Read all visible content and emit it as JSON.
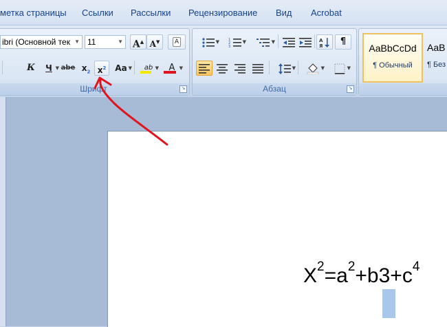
{
  "menu_tabs": [
    "метка страницы",
    "Ссылки",
    "Рассылки",
    "Рецензирование",
    "Вид",
    "Acrobat"
  ],
  "font_group": {
    "font_name": "ibri (Основной тек",
    "font_size": "11",
    "grow_font": "A",
    "shrink_font": "A",
    "clear_format_glyph": "A",
    "italic": "К",
    "underline": "Ч",
    "strikethrough": "abe",
    "subscript": "x",
    "superscript": "x",
    "change_case": "Aa",
    "highlight": "ab",
    "font_color": "A",
    "label": "Шрифт",
    "colors": {
      "highlight": "#f5e800",
      "font_color": "#e0141c"
    }
  },
  "paragraph_group": {
    "label": "Абзац",
    "pilcrow": "¶"
  },
  "styles_gallery": [
    {
      "sample": "AaBbCcDd",
      "name": "¶ Обычный",
      "active": true
    },
    {
      "sample": "AaB",
      "name": "¶ Без",
      "active": false
    }
  ],
  "document": {
    "base": "X",
    "exp1": "2",
    "eq": "=a",
    "exp2": "2",
    "plus_b": "+b",
    "selected": "3",
    "plus_c": "+c",
    "exp3": "4"
  },
  "annotation": {
    "color": "#e0141c"
  }
}
